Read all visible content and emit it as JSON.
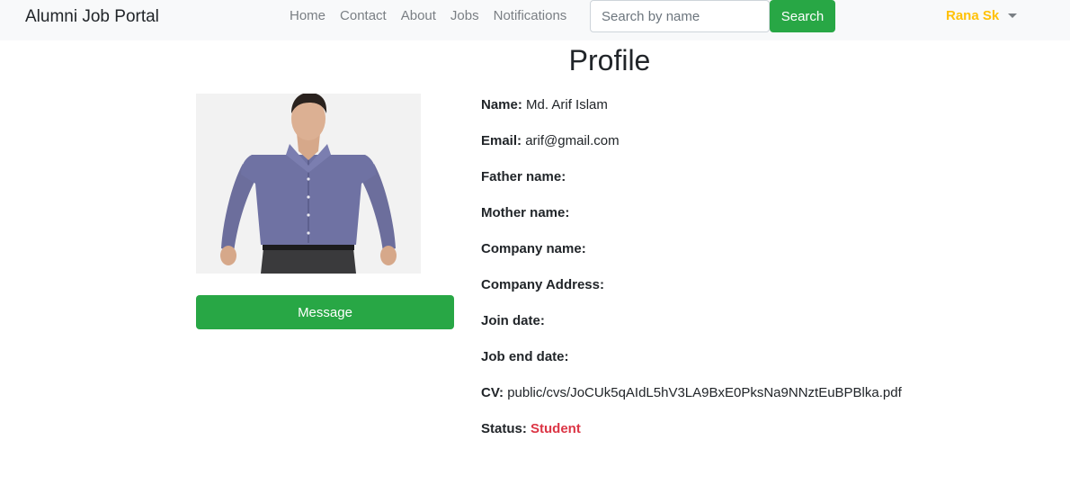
{
  "navbar": {
    "brand": "Alumni Job Portal",
    "links": [
      "Home",
      "Contact",
      "About",
      "Jobs",
      "Notifications"
    ],
    "search_placeholder": "Search by name",
    "search_label": "Search",
    "user_name": "Rana Sk"
  },
  "page": {
    "title": "Profile"
  },
  "profile": {
    "message_label": "Message",
    "fields": [
      {
        "label": "Name:",
        "value": "Md. Arif Islam"
      },
      {
        "label": "Email:",
        "value": "arif@gmail.com"
      },
      {
        "label": "Father name:",
        "value": ""
      },
      {
        "label": "Mother name:",
        "value": ""
      },
      {
        "label": "Company name:",
        "value": ""
      },
      {
        "label": "Company Address:",
        "value": ""
      },
      {
        "label": "Join date:",
        "value": ""
      },
      {
        "label": "Job end date:",
        "value": ""
      },
      {
        "label": "CV:",
        "value": "public/cvs/JoCUk5qAIdL5hV3LA9BxE0PksNa9NNztEuBPBlka.pdf"
      }
    ],
    "status": {
      "label": "Status:",
      "value": "Student"
    }
  },
  "colors": {
    "navbar_bg": "#f8f9fa",
    "success": "#28a745",
    "warning": "#ffc107",
    "danger": "#dc3545"
  }
}
